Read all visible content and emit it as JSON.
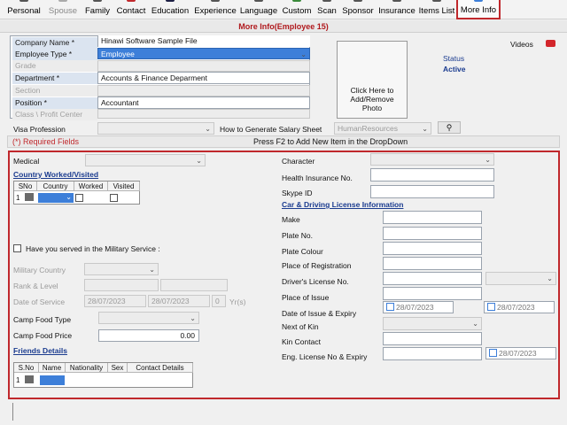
{
  "toolbar": {
    "items": [
      {
        "label": "Personal",
        "enabled": true
      },
      {
        "label": "Spouse",
        "enabled": false
      },
      {
        "label": "Family",
        "enabled": true
      },
      {
        "label": "Contact",
        "enabled": true
      },
      {
        "label": "Education",
        "enabled": true
      },
      {
        "label": "Experience",
        "enabled": true
      },
      {
        "label": "Language",
        "enabled": true
      },
      {
        "label": "Custom",
        "enabled": true
      },
      {
        "label": "Scan",
        "enabled": true
      },
      {
        "label": "Sponsor",
        "enabled": true
      },
      {
        "label": "Insurance",
        "enabled": true
      },
      {
        "label": "Items List",
        "enabled": true
      },
      {
        "label": "More Info",
        "enabled": true,
        "selected": true
      }
    ]
  },
  "window_title": "More Info(Employee 15)",
  "header": {
    "company_label": "Company Name  *",
    "company_value": "Hinawi Software Sample File",
    "employee_type_label": "Employee Type  *",
    "employee_type_value": "Employee",
    "grade_label": "Grade",
    "department_label": "Department  *",
    "department_value": "Accounts & Finance Deparment",
    "section_label": "Section",
    "position_label": "Position  *",
    "position_value": "Accountant",
    "class_label": "Class \\ Profit Center",
    "photo_text_1": "Click Here to",
    "photo_text_2": "Add/Remove",
    "photo_text_3": "Photo",
    "status_label": "Status",
    "status_value": "Active",
    "videos_label": "Videos",
    "visa_label": "Visa Profession",
    "salary_label": "How to Generate Salary Sheet",
    "salary_value": "HumanResources",
    "required_note": "(*) Required Fields",
    "dropdown_hint": "Press F2 to Add New Item in the DropDown"
  },
  "left": {
    "medical_label": "Medical",
    "countries_title": "Country Worked/Visited",
    "countries_columns": [
      "SNo",
      "Country",
      "Worked",
      "Visited"
    ],
    "countries_row_num": "1",
    "military_question": "Have you served in the Military Service :",
    "military_country_label": "Military Country",
    "rank_label": "Rank & Level",
    "date_service_label": "Date of Service",
    "date_from": "28/07/2023",
    "date_to": "28/07/2023",
    "years_value": "0",
    "years_unit": "Yr(s)",
    "camp_food_type_label": "Camp Food Type",
    "camp_food_price_label": "Camp Food Price",
    "camp_food_price_value": "0.00",
    "friends_title": "Friends Details",
    "friends_columns": [
      "S.No",
      "Name",
      "Nationality",
      "Sex",
      "Contact Details"
    ],
    "friends_row_num": "1"
  },
  "right": {
    "character_label": "Character",
    "health_ins_label": "Health Insurance No.",
    "skype_label": "Skype ID",
    "car_title": "Car & Driving License Information",
    "make_label": "Make",
    "plate_no_label": "Plate No.",
    "plate_colour_label": "Plate Colour",
    "place_reg_label": "Place of Registration",
    "license_no_label": "Driver's License No.",
    "place_issue_label": "Place of Issue",
    "date_issue_label": "Date of Issue & Expiry",
    "date_issue_value": "28/07/2023",
    "date_expiry_value": "28/07/2023",
    "next_kin_label": "Next of Kin",
    "kin_contact_label": "Kin Contact",
    "eng_license_label": "Eng. License No & Expiry",
    "eng_expiry_value": "28/07/2023"
  },
  "colors": {
    "accent_red": "#c0282c",
    "selection_blue": "#3d7fd9",
    "status_blue": "#1a3b8f"
  }
}
